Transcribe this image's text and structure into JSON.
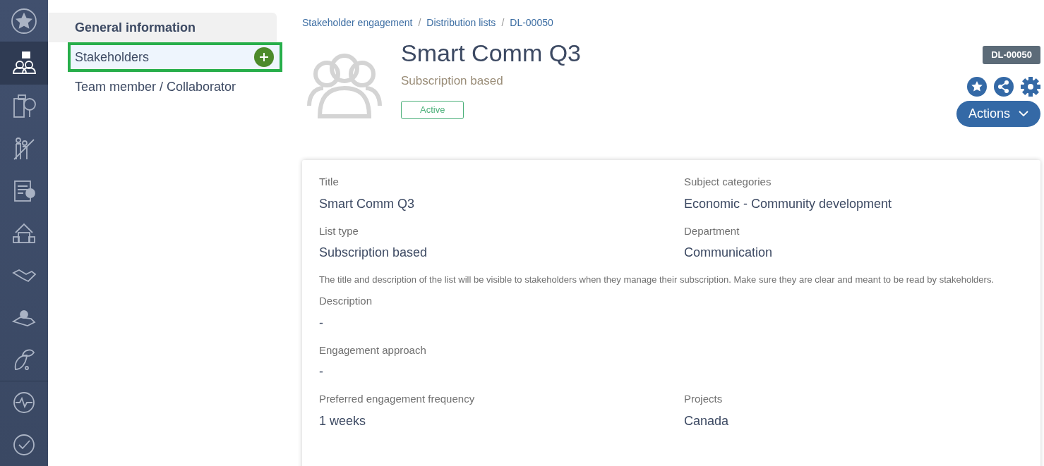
{
  "rail": [
    {
      "selected": false
    },
    {
      "selected": true
    },
    {
      "selected": false
    },
    {
      "selected": false
    },
    {
      "selected": false
    },
    {
      "selected": false
    },
    {
      "selected": false
    },
    {
      "selected": false
    },
    {
      "selected": false
    },
    {
      "selected": false
    },
    {
      "selected": false
    }
  ],
  "menu": [
    {
      "kind": "header",
      "label": "General information",
      "selected": false,
      "highlighted": false
    },
    {
      "kind": "item",
      "label": "Stakeholders",
      "selected": true,
      "highlighted": true,
      "add_button": true
    },
    {
      "kind": "item",
      "label": "Team member / Collaborator",
      "selected": false,
      "highlighted": false,
      "add_button": false
    }
  ],
  "breadcrumb": [
    {
      "kind": "link",
      "label": "Stakeholder engagement"
    },
    {
      "kind": "separator",
      "label": "/"
    },
    {
      "kind": "link",
      "label": "Distribution lists"
    },
    {
      "kind": "separator",
      "label": "/"
    },
    {
      "kind": "current",
      "label": "DL-00050"
    }
  ],
  "record": {
    "title": "Smart Comm Q3",
    "subtitle": "Subscription based",
    "status": "Active",
    "id_badge": "DL-00050",
    "actions_button": "Actions"
  },
  "rows": [
    {
      "kind": "fields",
      "fields": [
        {
          "label": "Title",
          "value": "Smart Comm Q3"
        },
        {
          "label": "Subject categories",
          "value": "Economic - Community development"
        }
      ]
    },
    {
      "kind": "fields",
      "fields": [
        {
          "label": "List type",
          "value": "Subscription based"
        },
        {
          "label": "Department",
          "value": "Communication"
        }
      ]
    },
    {
      "kind": "note",
      "text": "The title and description of the list will be visible to stakeholders when they manage their subscription. Make sure they are clear and meant to be read by stakeholders."
    },
    {
      "kind": "fields",
      "fields": [
        {
          "label": "Description",
          "value": "-"
        }
      ]
    },
    {
      "kind": "fields",
      "fields": [
        {
          "label": "Engagement approach",
          "value": "-"
        }
      ]
    },
    {
      "kind": "fields",
      "fields": [
        {
          "label": "Preferred engagement frequency",
          "value": "1 weeks"
        },
        {
          "label": "Projects",
          "value": "Canada"
        }
      ]
    }
  ]
}
